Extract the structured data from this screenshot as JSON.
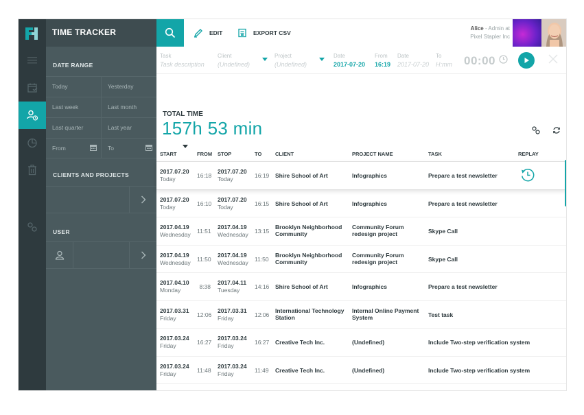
{
  "app": {
    "title": "TIME TRACKER",
    "accent_color": "#13a5a8",
    "rail_color": "#2e3a3e",
    "panel_color": "#4a5a5e"
  },
  "rail": {
    "logo": "fh-logo",
    "items": [
      "menu-icon",
      "calendar-check-icon",
      "user-time-icon",
      "pie-chart-icon",
      "trash-icon",
      "share-icon"
    ],
    "active_index": 2
  },
  "filters": {
    "date_range_title": "DATE RANGE",
    "today": "Today",
    "yesterday": "Yesterday",
    "last_week": "Last week",
    "last_month": "Last month",
    "last_quarter": "Last quarter",
    "last_year": "Last year",
    "from": "From",
    "to": "To",
    "clients_title": "CLIENTS AND PROJECTS",
    "user_title": "USER"
  },
  "toolbar": {
    "edit_label": "EDIT",
    "export_label": "EXPORT CSV",
    "user_name": "Alice",
    "user_role": " - Admin at",
    "user_company": "Pixel Stapler Inc"
  },
  "entry": {
    "task_label": "Task",
    "task_placeholder": "Task description",
    "client_label": "Client",
    "client_value": "(Undefined)",
    "project_label": "Project",
    "project_value": "(Undefined)",
    "date_label": "Date",
    "date_value": "2017-07-20",
    "from_label": "From",
    "from_value": "16:19",
    "end_date_label": "Date",
    "end_date_placeholder": "2017-07-20",
    "to_label": "To",
    "to_placeholder": "H:mm",
    "timer": "00:00"
  },
  "total": {
    "label": "TOTAL TIME",
    "value": "157h 53 min"
  },
  "table": {
    "headers": {
      "start": "START",
      "from": "FROM",
      "stop": "STOP",
      "to": "TO",
      "client": "CLIENT",
      "project": "PROJECT NAME",
      "task": "TASK",
      "replay": "REPLAY"
    },
    "rows": [
      {
        "start_date": "2017.07.20",
        "start_day": "Today",
        "from": "16:18",
        "stop_date": "2017.07.20",
        "stop_day": "Today",
        "to": "16:19",
        "client": "Shire School of Art",
        "project": "Infographics",
        "task": "Prepare a test newsletter"
      },
      {
        "start_date": "2017.07.20",
        "start_day": "Today",
        "from": "16:10",
        "stop_date": "2017.07.20",
        "stop_day": "Today",
        "to": "16:15",
        "client": "Shire School of Art",
        "project": "Infographics",
        "task": "Prepare a test newsletter"
      },
      {
        "start_date": "2017.04.19",
        "start_day": "Wednesday",
        "from": "11:51",
        "stop_date": "2017.04.19",
        "stop_day": "Wednesday",
        "to": "13:15",
        "client": "Brooklyn Neighborhood Community",
        "project": "Community Forum redesign project",
        "task": "Skype Call"
      },
      {
        "start_date": "2017.04.19",
        "start_day": "Wednesday",
        "from": "11:50",
        "stop_date": "2017.04.19",
        "stop_day": "Wednesday",
        "to": "11:50",
        "client": "Brooklyn Neighborhood Community",
        "project": "Community Forum redesign project",
        "task": "Skype Call"
      },
      {
        "start_date": "2017.04.10",
        "start_day": "Monday",
        "from": "8:38",
        "stop_date": "2017.04.11",
        "stop_day": "Tuesday",
        "to": "14:16",
        "client": "Shire School of Art",
        "project": "Infographics",
        "task": "Prepare a test newsletter"
      },
      {
        "start_date": "2017.03.31",
        "start_day": "Friday",
        "from": "12:06",
        "stop_date": "2017.03.31",
        "stop_day": "Friday",
        "to": "12:06",
        "client": "International Technology Station",
        "project": "Internal Online Payment System",
        "task": "Test task"
      },
      {
        "start_date": "2017.03.24",
        "start_day": "Friday",
        "from": "16:27",
        "stop_date": "2017.03.24",
        "stop_day": "Friday",
        "to": "16:27",
        "client": "Creative Tech Inc.",
        "project": "(Undefined)",
        "task": "Include Two-step verification system"
      },
      {
        "start_date": "2017.03.24",
        "start_day": "Friday",
        "from": "11:48",
        "stop_date": "2017.03.24",
        "stop_day": "Friday",
        "to": "11:49",
        "client": "Creative Tech Inc.",
        "project": "(Undefined)",
        "task": "Include Two-step verification system"
      }
    ]
  }
}
